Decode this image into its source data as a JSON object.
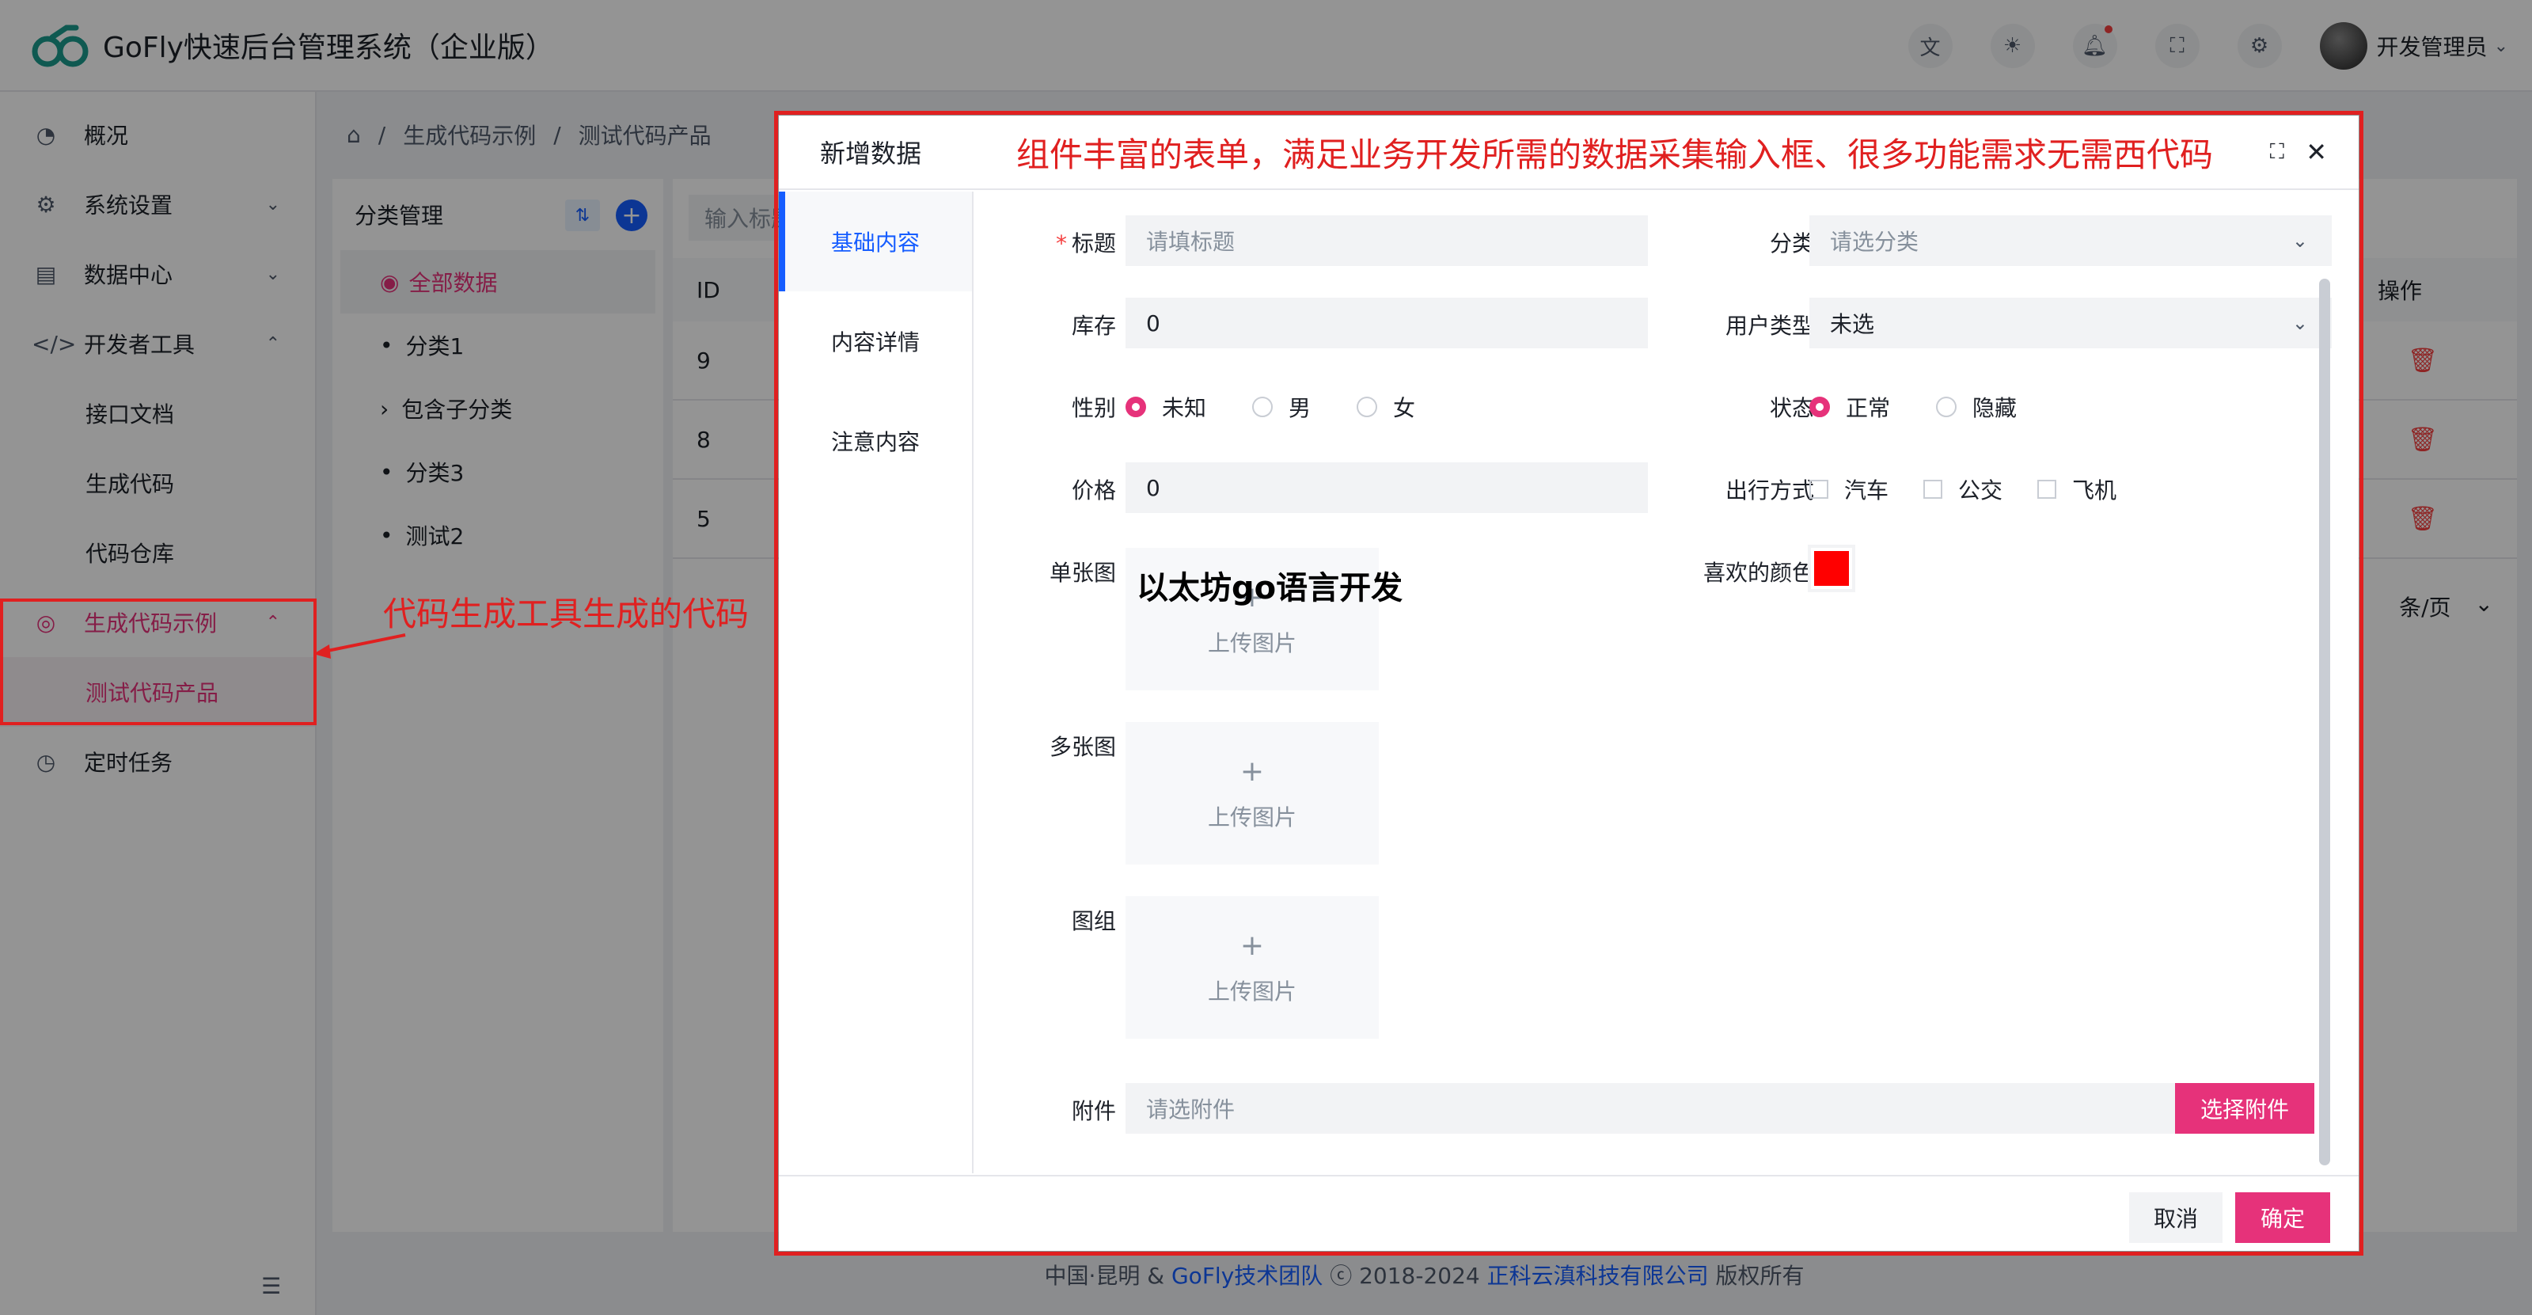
{
  "app": {
    "title": "GoFly快速后台管理系统（企业版）"
  },
  "header": {
    "icons": [
      "translate-icon",
      "theme-icon",
      "bell-icon",
      "fullscreen-icon",
      "settings-icon"
    ],
    "user_name": "开发管理员"
  },
  "sidebar": {
    "items": [
      {
        "label": "概况",
        "icon": "dashboard-icon"
      },
      {
        "label": "系统设置",
        "icon": "gear-icon"
      },
      {
        "label": "数据中心",
        "icon": "database-icon"
      },
      {
        "label": "开发者工具",
        "icon": "code-icon"
      },
      {
        "label": "接口文档"
      },
      {
        "label": "生成代码"
      },
      {
        "label": "代码仓库"
      },
      {
        "label": "生成代码示例",
        "icon": "compass-icon"
      },
      {
        "label": "测试代码产品"
      },
      {
        "label": "定时任务",
        "icon": "clock-icon"
      }
    ]
  },
  "annotations": {
    "sidebar_note": "代码生成工具生成的代码",
    "modal_banner": "组件丰富的表单，满足业务开发所需的数据采集输入框、很多功能需求无需西代码",
    "watermark": "以太坊go语言开发"
  },
  "breadcrumb": [
    "生成代码示例",
    "测试代码产品"
  ],
  "category": {
    "title": "分类管理",
    "items": [
      "全部数据",
      "分类1",
      "包含子分类",
      "分类3",
      "测试2"
    ]
  },
  "table": {
    "search_placeholder": "输入标题",
    "col_id": "ID",
    "col_op": "操作",
    "rows": [
      "9",
      "8",
      "5"
    ],
    "page_size": "条/页"
  },
  "footer": {
    "prefix": "中国·昆明 &",
    "team": "GoFly技术团队",
    "copy": "ⓒ 2018-2024",
    "company": "正科云滇科技有限公司",
    "suffix": "版权所有"
  },
  "modal": {
    "title": "新增数据",
    "tabs": [
      "基础内容",
      "内容详情",
      "注意内容"
    ],
    "labels": {
      "title": "标题",
      "category": "分类",
      "stock": "库存",
      "user_type": "用户类型",
      "gender": "性别",
      "status": "状态",
      "price": "价格",
      "travel": "出行方式",
      "single_image": "单张图",
      "fav_color": "喜欢的颜色",
      "multi_image": "多张图",
      "image_group": "图组",
      "attachment": "附件"
    },
    "title_placeholder": "请填标题",
    "category_placeholder": "请选分类",
    "stock_value": "0",
    "user_type_value": "未选",
    "gender_options": [
      "未知",
      "男",
      "女"
    ],
    "status_options": [
      "正常",
      "隐藏"
    ],
    "price_value": "0",
    "travel_options": [
      "汽车",
      "公交",
      "飞机"
    ],
    "upload_text": "上传图片",
    "fav_color_value": "#ff0000",
    "attachment_placeholder": "请选附件",
    "attachment_button": "选择附件",
    "cancel": "取消",
    "confirm": "确定"
  }
}
